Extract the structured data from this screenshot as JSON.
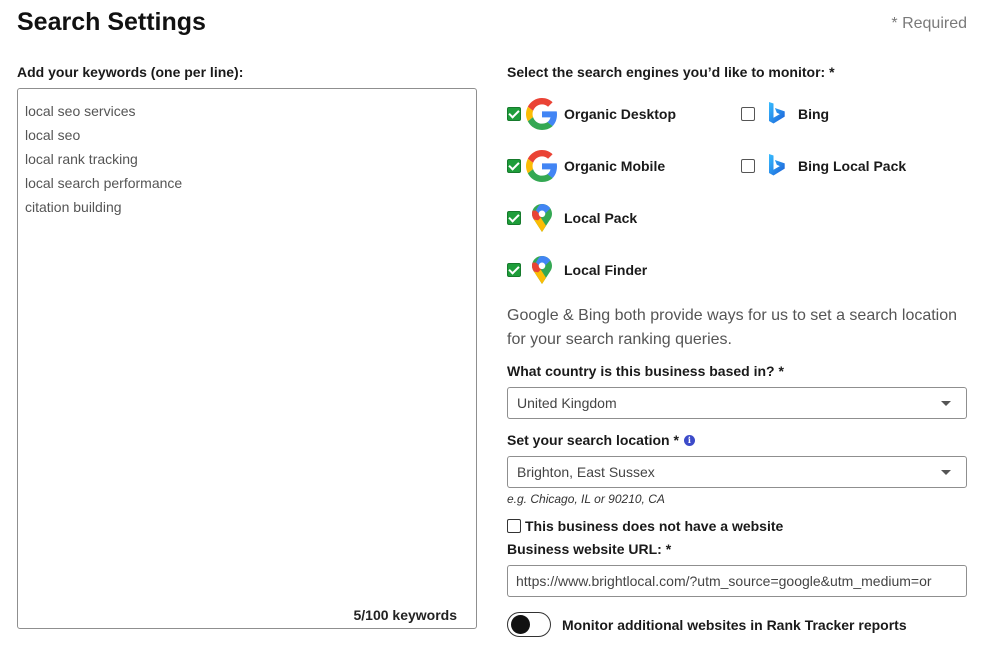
{
  "header": {
    "title": "Search Settings",
    "required_note": "* Required"
  },
  "keywords": {
    "label": "Add your keywords (one per line):",
    "lines": [
      "local seo services",
      "local seo",
      "local rank tracking",
      "local search performance",
      "citation building"
    ],
    "count_text": "5/100 keywords"
  },
  "engines": {
    "label": "Select the search engines you’d like to monitor: *",
    "items": [
      {
        "label": "Organic Desktop",
        "checked": true,
        "icon": "google-icon"
      },
      {
        "label": "Bing",
        "checked": false,
        "icon": "bing-icon"
      },
      {
        "label": "Organic Mobile",
        "checked": true,
        "icon": "google-icon"
      },
      {
        "label": "Bing Local Pack",
        "checked": false,
        "icon": "bing-icon"
      },
      {
        "label": "Local Pack",
        "checked": true,
        "icon": "google-maps-pin-icon"
      },
      {
        "label": "Local Finder",
        "checked": true,
        "icon": "google-maps-pin-icon"
      }
    ]
  },
  "location": {
    "info_text": "Google & Bing both provide ways for us to set a search location for your search ranking queries.",
    "country_label": "What country is this business based in? *",
    "country_value": "United Kingdom",
    "location_label": "Set your search location *",
    "location_value": "Brighton, East Sussex",
    "example": "e.g. Chicago, IL or 90210, CA"
  },
  "website": {
    "no_website_label": "This business does not have a website",
    "no_website_checked": false,
    "url_label": "Business website URL: *",
    "url_value": "https://www.brightlocal.com/?utm_source=google&utm_medium=or",
    "monitor_label": "Monitor additional websites in Rank Tracker reports",
    "monitor_on": false
  },
  "colors": {
    "checkbox_checked": "#1e9d3a",
    "info_icon": "#3c4bc9"
  }
}
